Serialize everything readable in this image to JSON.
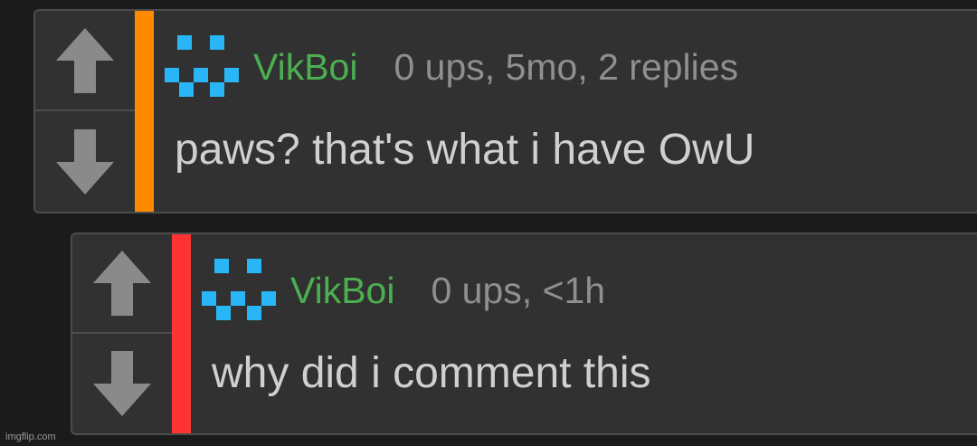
{
  "comments": [
    {
      "author": "VikBoi",
      "meta": "0 ups, 5mo, 2 replies",
      "text": "paws? that's what i have OwU",
      "stripe_color": "#ff8a00",
      "upvote_icon": "arrow-up-icon",
      "downvote_icon": "arrow-down-icon"
    },
    {
      "author": "VikBoi",
      "meta": "0 ups, <1h",
      "text": "why did i comment this",
      "stripe_color": "#ff3333",
      "upvote_icon": "arrow-up-icon",
      "downvote_icon": "arrow-down-icon"
    }
  ],
  "colors": {
    "author": "#4caf50",
    "avatar": "#29b6f6",
    "arrow": "#8a8a8a"
  },
  "watermark": "imgflip.com"
}
